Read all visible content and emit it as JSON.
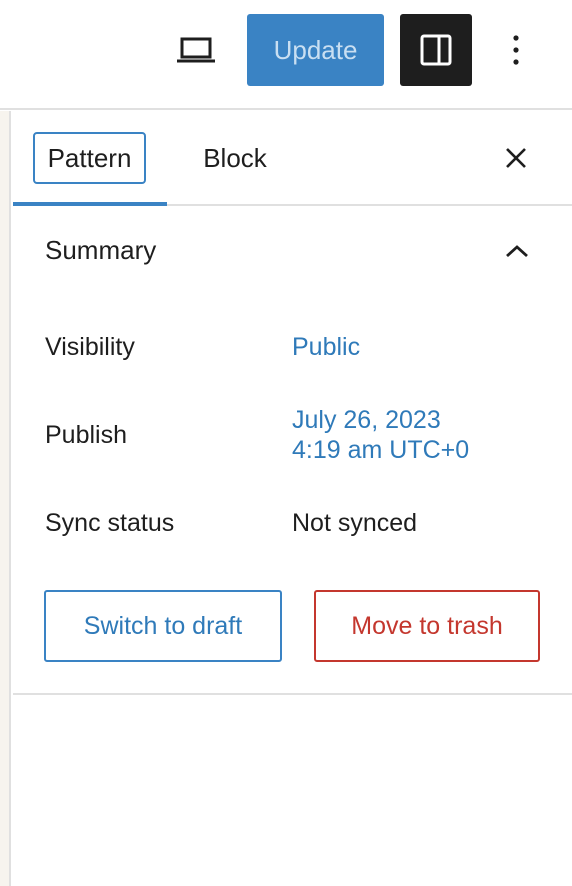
{
  "topbar": {
    "preview_icon": "laptop-icon",
    "update_label": "Update",
    "settings_icon": "sidebar-toggle-icon",
    "options_icon": "vertical-ellipsis-icon"
  },
  "tabs": [
    {
      "label": "Pattern",
      "active": true
    },
    {
      "label": "Block",
      "active": false
    }
  ],
  "close_icon": "close-icon",
  "summary": {
    "title": "Summary",
    "collapse_icon": "chevron-up-icon",
    "rows": [
      {
        "label": "Visibility",
        "value": "Public"
      },
      {
        "label": "Publish",
        "value_line1": "July 26, 2023",
        "value_line2": "4:19 am UTC+0"
      },
      {
        "label": "Sync status",
        "value": "Not synced"
      }
    ],
    "switch_draft_label": "Switch to draft",
    "move_trash_label": "Move to trash"
  },
  "colors": {
    "accent": "#3a83c4",
    "link": "#2f7ab9",
    "danger": "#c4372e",
    "dark": "#1e1e1e"
  }
}
